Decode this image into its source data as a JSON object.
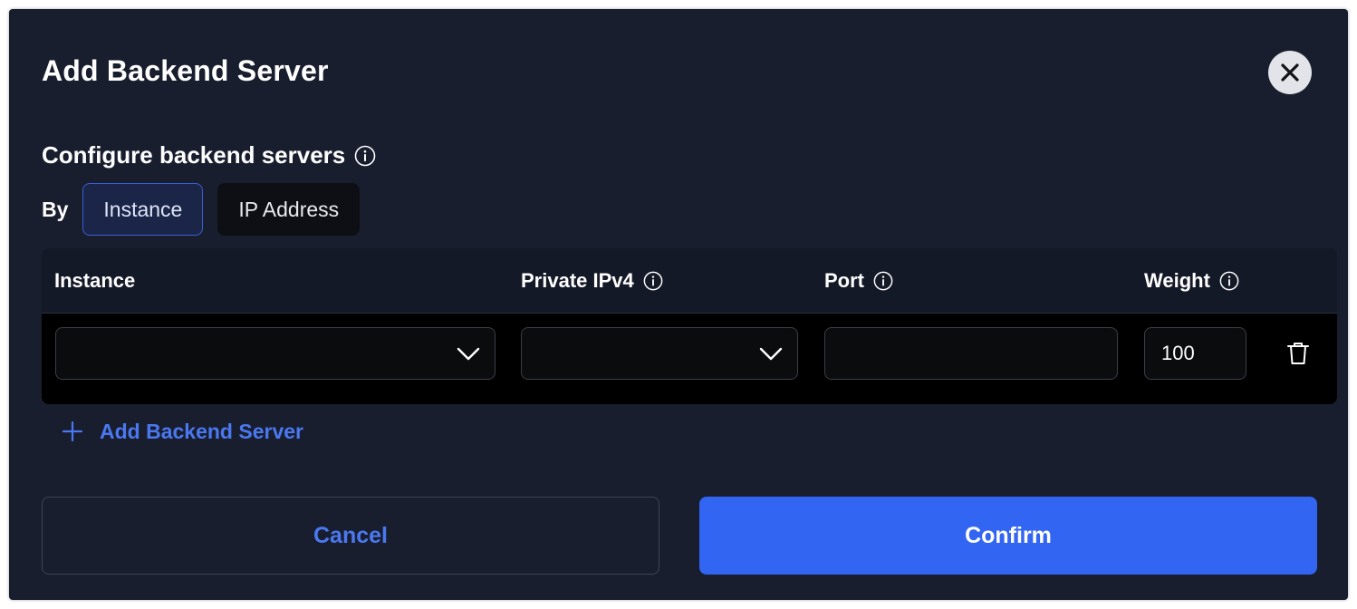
{
  "dialog": {
    "title": "Add Backend Server",
    "close_icon": "close-icon"
  },
  "configure": {
    "title": "Configure backend servers",
    "info_icon": "info-icon",
    "by_label": "By",
    "options": [
      {
        "label": "Instance",
        "selected": true
      },
      {
        "label": "IP Address",
        "selected": false
      }
    ]
  },
  "table": {
    "headers": {
      "instance": "Instance",
      "private_ipv4": "Private IPv4",
      "port": "Port",
      "weight": "Weight"
    },
    "rows": [
      {
        "instance": "",
        "private_ipv4": "",
        "port": "",
        "weight": "100"
      }
    ]
  },
  "add_link": {
    "label": "Add Backend Server",
    "icon": "plus-icon"
  },
  "footer": {
    "cancel_label": "Cancel",
    "confirm_label": "Confirm"
  },
  "colors": {
    "background": "#181e2e",
    "accent": "#3365f3",
    "link": "#4b78f0"
  }
}
